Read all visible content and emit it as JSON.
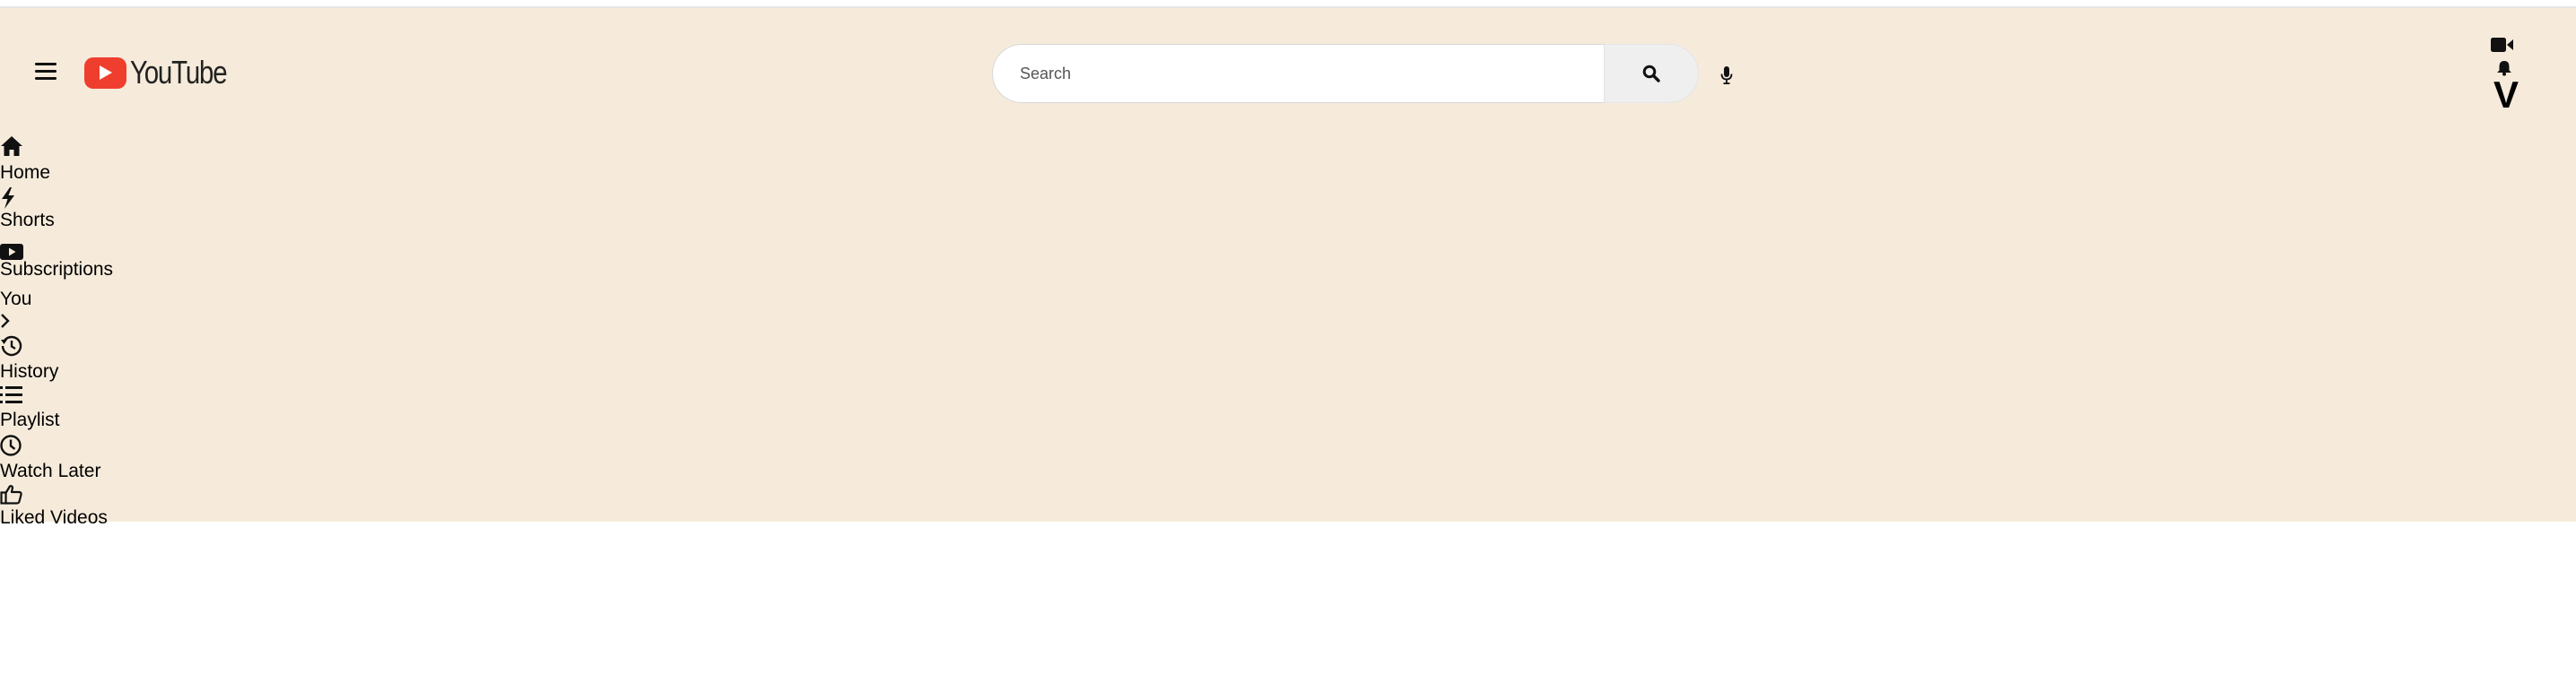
{
  "header": {
    "logo_text": "YouTube",
    "search": {
      "placeholder": "Search",
      "value": ""
    },
    "avatar_letter": "V"
  },
  "icons": {
    "menu": "hamburger-menu-icon",
    "logo": "youtube-play-logo",
    "search": "magnifier-icon",
    "mic": "microphone-icon",
    "create": "video-camera-icon",
    "notifications": "bell-icon"
  },
  "colors": {
    "app_background": "#f6ebdb",
    "logo_red": "#f03e2e",
    "search_button_bg": "#efefef"
  },
  "sidebar": {
    "items": [
      {
        "label": "Home",
        "icon": "home-icon"
      },
      {
        "label": "Shorts",
        "icon": "lightning-icon"
      },
      {
        "label": "Subscriptions",
        "icon": "subscriptions-icon"
      },
      {
        "label": "You",
        "icon": "chevron-right-icon"
      },
      {
        "label": "History",
        "icon": "history-icon"
      },
      {
        "label": "Playlist",
        "icon": "playlist-icon"
      },
      {
        "label": "Watch Later",
        "icon": "clock-icon"
      },
      {
        "label": "Liked Videos",
        "icon": "thumbs-up-icon"
      }
    ]
  }
}
